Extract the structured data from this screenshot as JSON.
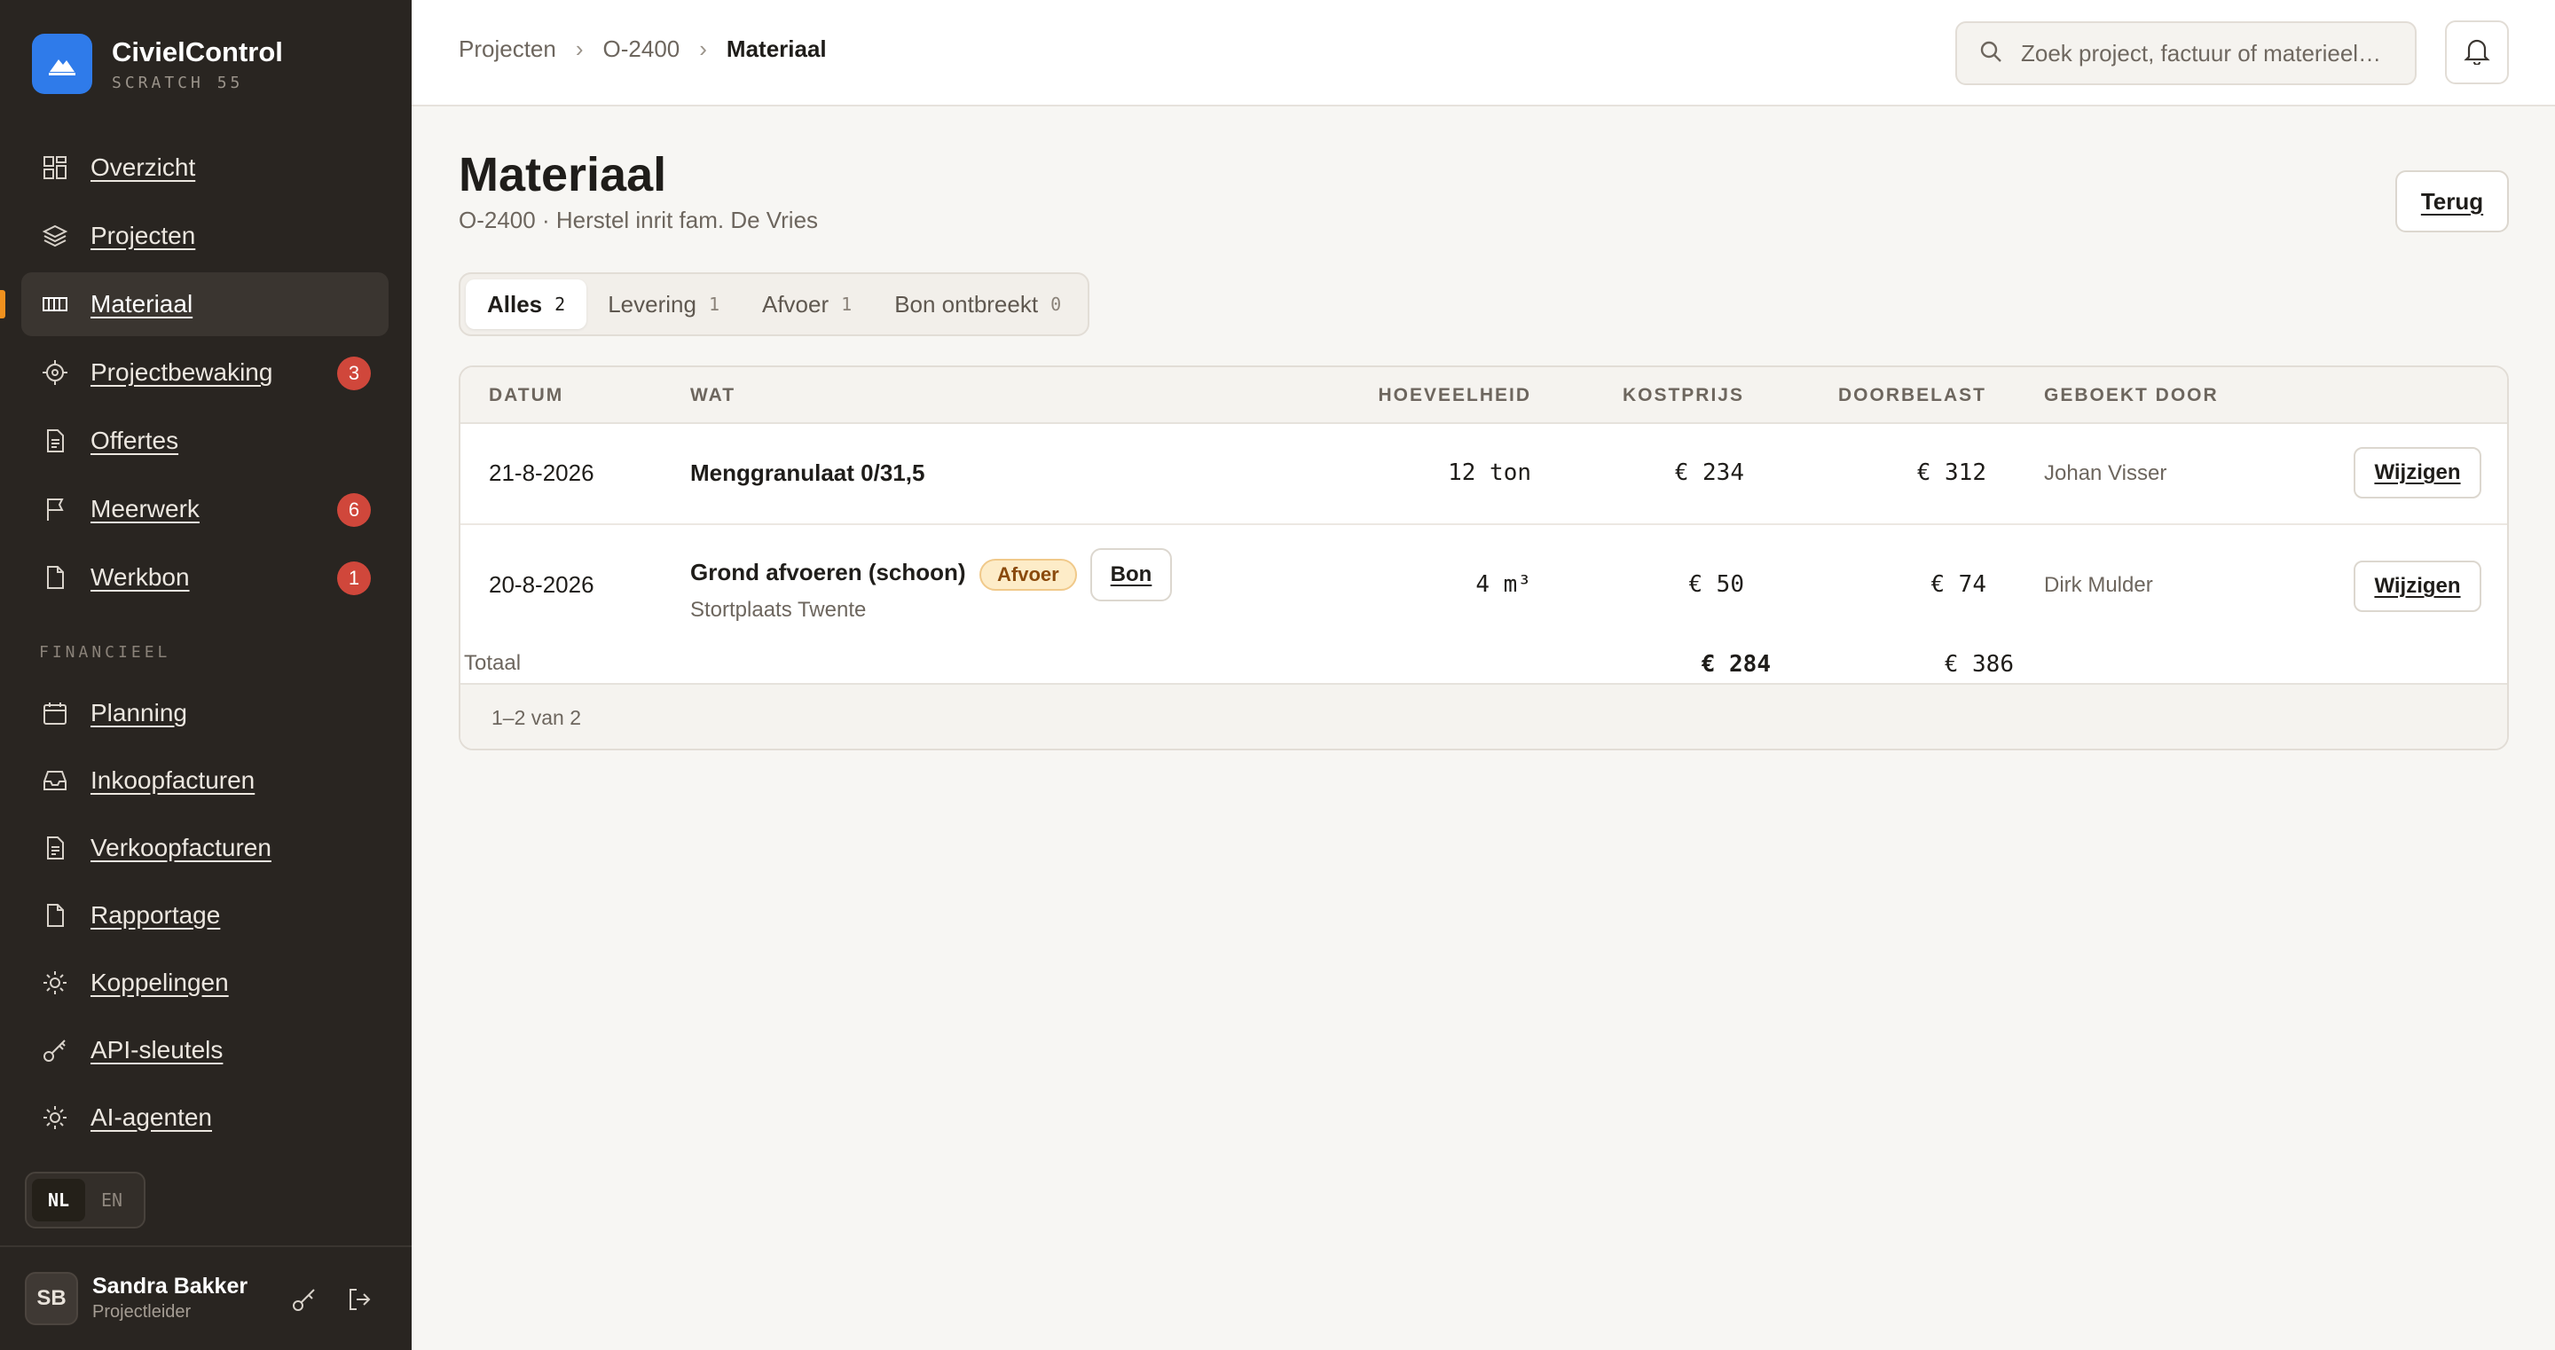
{
  "app": {
    "name": "CivielControl",
    "subtitle": "SCRATCH 55",
    "brand_color": "#2f7bea",
    "accent_color": "#f0911e"
  },
  "nav": {
    "items": [
      {
        "label": "Overzicht",
        "icon": "dashboard-icon"
      },
      {
        "label": "Projecten",
        "icon": "layers-icon"
      },
      {
        "label": "Materiaal",
        "icon": "material-icon",
        "active": true
      },
      {
        "label": "Projectbewaking",
        "icon": "target-icon",
        "badge": "3"
      },
      {
        "label": "Offertes",
        "icon": "document-icon"
      },
      {
        "label": "Meerwerk",
        "icon": "flag-icon",
        "badge": "6"
      },
      {
        "label": "Werkbon",
        "icon": "file-icon",
        "badge": "1"
      }
    ],
    "section_label": "FINANCIEEL",
    "finance_items": [
      {
        "label": "Planning",
        "icon": "calendar-icon"
      },
      {
        "label": "Inkoopfacturen",
        "icon": "inbox-icon"
      },
      {
        "label": "Verkoopfacturen",
        "icon": "invoice-icon"
      },
      {
        "label": "Rapportage",
        "icon": "report-icon"
      },
      {
        "label": "Koppelingen",
        "icon": "plug-icon"
      },
      {
        "label": "API-sleutels",
        "icon": "key-icon"
      },
      {
        "label": "AI-agenten",
        "icon": "sparkle-icon"
      }
    ]
  },
  "lang": {
    "nl": "NL",
    "en": "EN",
    "selected": "NL"
  },
  "user": {
    "initials": "SB",
    "name": "Sandra Bakker",
    "role": "Projectleider"
  },
  "breadcrumb": {
    "items": [
      "Projecten",
      "O-2400"
    ],
    "current": "Materiaal"
  },
  "search": {
    "placeholder": "Zoek project, factuur of materieel…",
    "value": ""
  },
  "page": {
    "title": "Materiaal",
    "subtitle": "O-2400 · Herstel inrit fam. De Vries",
    "back_label": "Terug"
  },
  "tabs": [
    {
      "label": "Alles",
      "count": "2",
      "active": true
    },
    {
      "label": "Levering",
      "count": "1"
    },
    {
      "label": "Afvoer",
      "count": "1"
    },
    {
      "label": "Bon ontbreekt",
      "count": "0"
    }
  ],
  "table": {
    "columns": {
      "datum": "DATUM",
      "wat": "WAT",
      "hoeveelheid": "HOEVEELHEID",
      "kostprijs": "KOSTPRIJS",
      "doorbelast": "DOORBELAST",
      "geboekt_door": "GEBOEKT DOOR"
    },
    "rows": [
      {
        "datum": "21-8-2026",
        "wat": "Menggranulaat 0/31,5",
        "hoeveelheid": "12 ton",
        "kostprijs": "€ 234",
        "doorbelast": "€ 312",
        "geboekt_door": "Johan Visser",
        "action": "Wijzigen"
      },
      {
        "datum": "20-8-2026",
        "wat": "Grond afvoeren (schoon)",
        "tag": "Afvoer",
        "bon": "Bon",
        "sub": "Stortplaats Twente",
        "hoeveelheid": "4 m³",
        "kostprijs": "€ 50",
        "doorbelast": "€ 74",
        "geboekt_door": "Dirk Mulder",
        "action": "Wijzigen"
      }
    ],
    "totals": {
      "label": "Totaal",
      "kostprijs": "€ 284",
      "doorbelast": "€ 386"
    },
    "pagination": "1–2 van 2"
  }
}
